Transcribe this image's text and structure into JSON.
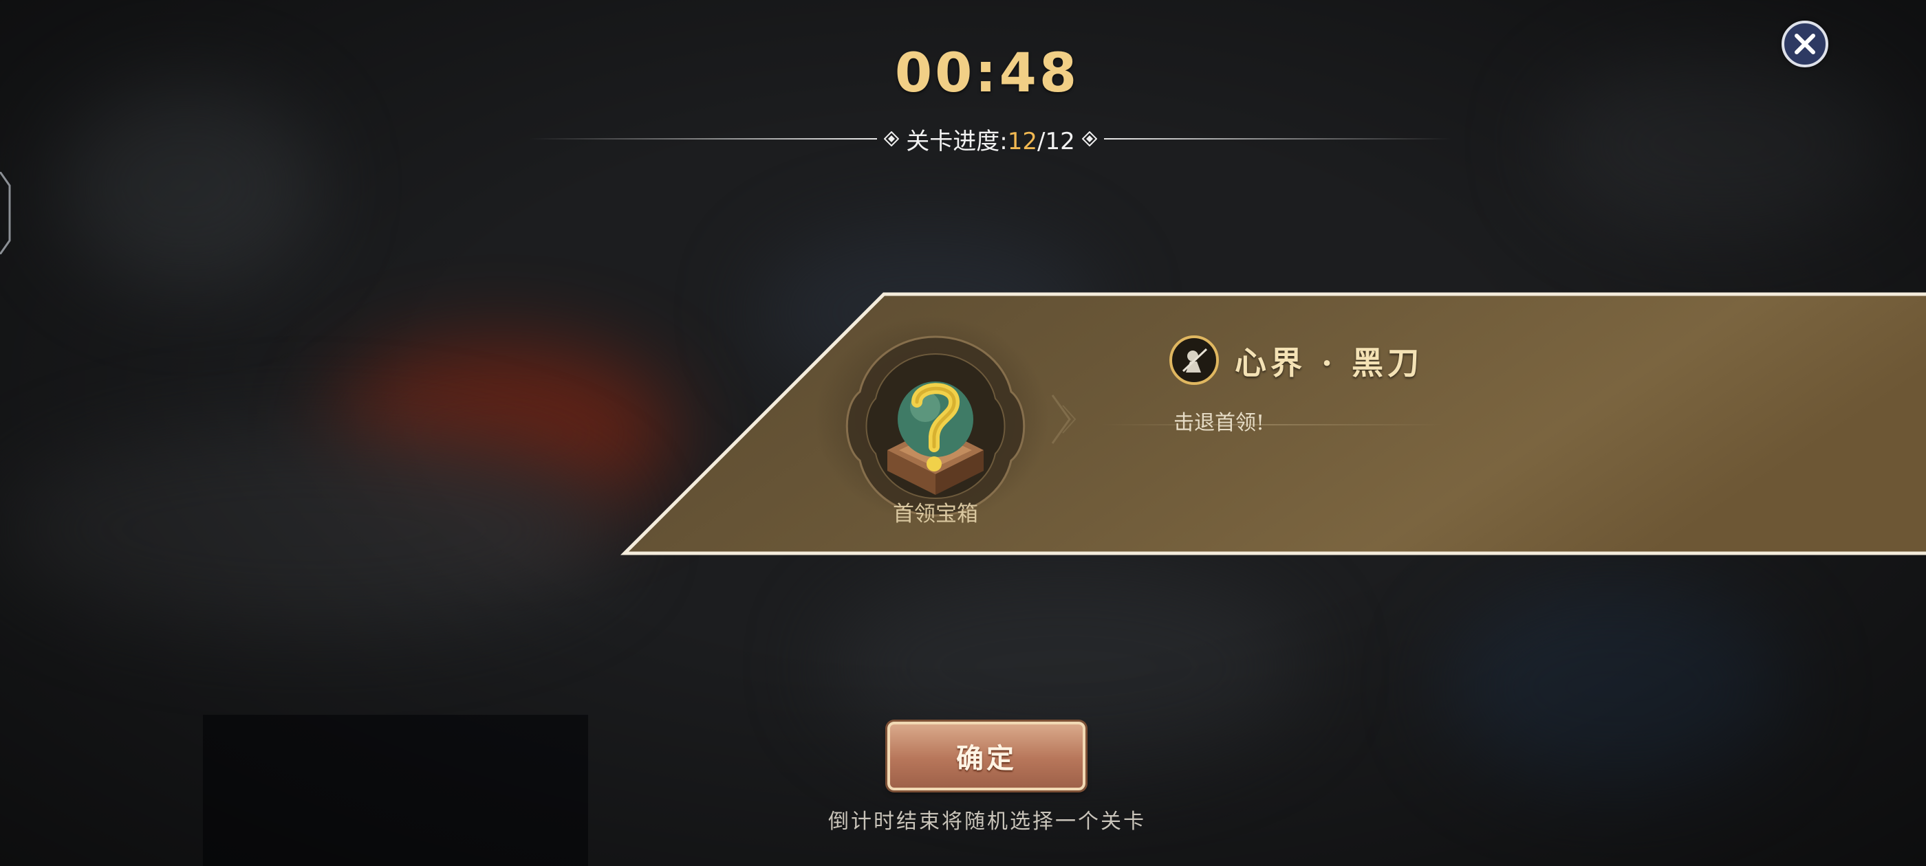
{
  "timer": {
    "value": "00:48"
  },
  "progress": {
    "label": "关卡进度:",
    "current": "12",
    "separator": "/",
    "total": "12"
  },
  "stage_card": {
    "reward_label": "首领宝箱",
    "boss_name": "心界 · 黑刀",
    "objective": "击退首领!"
  },
  "footer": {
    "confirm_label": "确定",
    "hint": "倒计时结束将随机选择一个关卡"
  },
  "colors": {
    "timer": "#f1cf86",
    "progress_current": "#f1b852",
    "banner": "#6a5838",
    "button": "#b7765a"
  },
  "icons": {
    "close": "close-icon",
    "reward": "mystery-chest-icon",
    "boss": "boss-emblem-icon"
  }
}
